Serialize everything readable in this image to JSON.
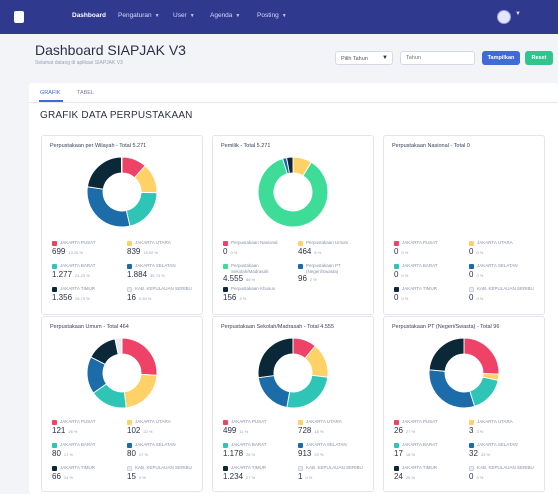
{
  "nav": {
    "items": [
      {
        "label": "Dashboard",
        "caret": false,
        "active": true
      },
      {
        "label": "Pengaturan",
        "caret": true
      },
      {
        "label": "User",
        "caret": true
      },
      {
        "label": "Agenda",
        "caret": true
      },
      {
        "label": "Posting",
        "caret": true
      }
    ]
  },
  "header": {
    "title": "Dashboard SIAPJAK V3",
    "subtitle": "Selamat datang di aplikasi SIAPJAK V3"
  },
  "filter": {
    "year_value": "Pilih Tahun",
    "search_placeholder": "Tahun",
    "apply_label": "Tampilkan",
    "reset_label": "Reset"
  },
  "tabs": [
    {
      "label": "GRAFIK",
      "active": true
    },
    {
      "label": "TABEL",
      "active": false
    }
  ],
  "section_title": "GRAFIK DATA PERPUSTAKAAN",
  "colors": {
    "nav_bg": "#2f3a8f",
    "accent_blue": "#3f6ad8",
    "accent_green": "#31c48d",
    "pink": "#ee4266",
    "yellow": "#ffd166",
    "teal": "#2ec4b6",
    "blue": "#1b6ca8",
    "dark": "#0b2838",
    "light": "#e9ecf3",
    "mint": "#3ddc97"
  },
  "panels": [
    {
      "title": "Perpustakaan per Wilayah - Total 5.271",
      "chart_data": {
        "type": "pie",
        "values": [
          699,
          839,
          1277,
          1884,
          1356,
          16
        ]
      },
      "legend": [
        {
          "label": "JAKARTA PUSAT",
          "value": "699",
          "pct": "13,26 %",
          "color": "#ee4266"
        },
        {
          "label": "JAKARTA UTARA",
          "value": "839",
          "pct": "15,92 %",
          "color": "#ffd166"
        },
        {
          "label": "JAKARTA BARAT",
          "value": "1.277",
          "pct": "24,23 %",
          "color": "#2ec4b6"
        },
        {
          "label": "JAKARTA SELATAN",
          "value": "1.884",
          "pct": "35,74 %",
          "color": "#1b6ca8"
        },
        {
          "label": "JAKARTA TIMUR",
          "value": "1.356",
          "pct": "25,73 %",
          "color": "#0b2838"
        },
        {
          "label": "KAB. KEPULAUAN SERIBU",
          "value": "16",
          "pct": "0,30 %",
          "color": "#e9ecf3"
        }
      ]
    },
    {
      "title": "Pemilik - Total 5.271",
      "chart_data": {
        "type": "pie",
        "values": [
          0,
          464,
          4555,
          96,
          156
        ]
      },
      "legend": [
        {
          "label": "Perpustakaan Nasional",
          "value": "0",
          "pct": "0 %",
          "color": "#ee4266"
        },
        {
          "label": "Perpustakaan Umum",
          "value": "464",
          "pct": "8 %",
          "color": "#ffd166"
        },
        {
          "label": "Perpustakaan Sekolah/Madrasah",
          "value": "4.555",
          "pct": "86 %",
          "color": "#3ddc97"
        },
        {
          "label": "Perpustakaan PT (Negeri/Swasta)",
          "value": "96",
          "pct": "2 %",
          "color": "#1b6ca8"
        },
        {
          "label": "Perpustakaan Khusus",
          "value": "156",
          "pct": "3 %",
          "color": "#0b2838"
        }
      ]
    },
    {
      "title": "Perpustakaan Nasional - Total 0",
      "chart_data": {
        "type": "pie",
        "values": [
          0,
          0,
          0,
          0,
          0,
          0
        ]
      },
      "legend": [
        {
          "label": "JAKARTA PUSAT",
          "value": "0",
          "pct": "0 %",
          "color": "#ee4266"
        },
        {
          "label": "JAKARTA UTARA",
          "value": "0",
          "pct": "0 %",
          "color": "#ffd166"
        },
        {
          "label": "JAKARTA BARAT",
          "value": "0",
          "pct": "0 %",
          "color": "#2ec4b6"
        },
        {
          "label": "JAKARTA SELATAN",
          "value": "0",
          "pct": "0 %",
          "color": "#1b6ca8"
        },
        {
          "label": "JAKARTA TIMUR",
          "value": "0",
          "pct": "0 %",
          "color": "#0b2838"
        },
        {
          "label": "KAB. KEPULAUAN SERIBU",
          "value": "0",
          "pct": "0 %",
          "color": "#e9ecf3"
        }
      ]
    },
    {
      "title": "Perpustakaan Umum - Total 464",
      "chart_data": {
        "type": "pie",
        "values": [
          121,
          102,
          80,
          80,
          66,
          15
        ]
      },
      "legend": [
        {
          "label": "JAKARTA PUSAT",
          "value": "121",
          "pct": "26 %",
          "color": "#ee4266"
        },
        {
          "label": "JAKARTA UTARA",
          "value": "102",
          "pct": "22 %",
          "color": "#ffd166"
        },
        {
          "label": "JAKARTA BARAT",
          "value": "80",
          "pct": "17 %",
          "color": "#2ec4b6"
        },
        {
          "label": "JAKARTA SELATAN",
          "value": "80",
          "pct": "17 %",
          "color": "#1b6ca8"
        },
        {
          "label": "JAKARTA TIMUR",
          "value": "66",
          "pct": "14 %",
          "color": "#0b2838"
        },
        {
          "label": "KAB. KEPULAUAN SERIBU",
          "value": "15",
          "pct": "3 %",
          "color": "#e9ecf3"
        }
      ]
    },
    {
      "title": "Perpustakaan Sekolah/Madrasah - Total 4.555",
      "chart_data": {
        "type": "pie",
        "values": [
          499,
          728,
          1178,
          913,
          1234,
          1
        ]
      },
      "legend": [
        {
          "label": "JAKARTA PUSAT",
          "value": "499",
          "pct": "11 %",
          "color": "#ee4266"
        },
        {
          "label": "JAKARTA UTARA",
          "value": "728",
          "pct": "16 %",
          "color": "#ffd166"
        },
        {
          "label": "JAKARTA BARAT",
          "value": "1.178",
          "pct": "26 %",
          "color": "#2ec4b6"
        },
        {
          "label": "JAKARTA SELATAN",
          "value": "913",
          "pct": "20 %",
          "color": "#1b6ca8"
        },
        {
          "label": "JAKARTA TIMUR",
          "value": "1.234",
          "pct": "27 %",
          "color": "#0b2838"
        },
        {
          "label": "KAB. KEPULAUAN SERIBU",
          "value": "1",
          "pct": "0 %",
          "color": "#e9ecf3"
        }
      ]
    },
    {
      "title": "Perpustakaan PT (Negeri/Swasta) - Total 96",
      "chart_data": {
        "type": "pie",
        "values": [
          26,
          3,
          17,
          32,
          24,
          0
        ]
      },
      "legend": [
        {
          "label": "JAKARTA PUSAT",
          "value": "26",
          "pct": "27 %",
          "color": "#ee4266"
        },
        {
          "label": "JAKARTA UTARA",
          "value": "3",
          "pct": "3 %",
          "color": "#ffd166"
        },
        {
          "label": "JAKARTA BARAT",
          "value": "17",
          "pct": "18 %",
          "color": "#2ec4b6"
        },
        {
          "label": "JAKARTA SELATAN",
          "value": "32",
          "pct": "33 %",
          "color": "#1b6ca8"
        },
        {
          "label": "JAKARTA TIMUR",
          "value": "24",
          "pct": "25 %",
          "color": "#0b2838"
        },
        {
          "label": "KAB. KEPULAUAN SERIBU",
          "value": "0",
          "pct": "0 %",
          "color": "#e9ecf3"
        }
      ]
    }
  ]
}
